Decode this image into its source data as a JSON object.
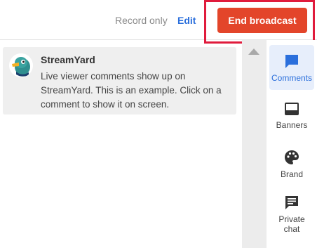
{
  "header": {
    "record_only_label": "Record only",
    "edit_label": "Edit",
    "end_broadcast_label": "End broadcast"
  },
  "comment": {
    "author": "StreamYard",
    "text": "Live viewer comments show up on StreamYard. This is an example. Click on a comment to show it on screen."
  },
  "sidebar": {
    "items": [
      {
        "label": "Comments",
        "icon": "comments-icon",
        "active": true
      },
      {
        "label": "Banners",
        "icon": "banner-icon",
        "active": false
      },
      {
        "label": "Brand",
        "icon": "palette-icon",
        "active": false
      },
      {
        "label": "Private chat",
        "icon": "chat-icon",
        "active": false
      }
    ]
  },
  "colors": {
    "accent_blue": "#2b6fdc",
    "end_button": "#e3452a",
    "highlight_border": "#e01b3c"
  }
}
